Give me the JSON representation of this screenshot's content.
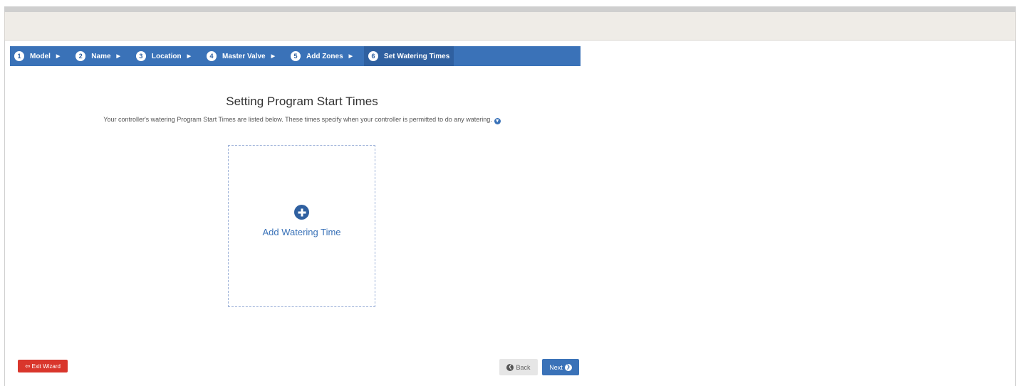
{
  "wizard": {
    "steps": [
      {
        "num": "1",
        "label": "Model"
      },
      {
        "num": "2",
        "label": "Name"
      },
      {
        "num": "3",
        "label": "Location"
      },
      {
        "num": "4",
        "label": "Master Valve"
      },
      {
        "num": "5",
        "label": "Add Zones"
      },
      {
        "num": "6",
        "label": "Set Watering Times"
      }
    ],
    "active_step": 6
  },
  "main": {
    "title": "Setting Program Start Times",
    "subtitle": "Your controller's watering Program Start Times are listed below. These times specify when your controller is permitted to do any watering.",
    "add_card_label": "Add Watering Time"
  },
  "footer": {
    "exit_label": "Exit Wizard",
    "back_label": "Back",
    "next_label": "Next"
  },
  "icons": {
    "info": "info-circle-icon",
    "add": "plus-circle-icon",
    "exit": "sign-out-icon",
    "back": "chevron-left-circle-icon",
    "next": "chevron-right-circle-icon"
  },
  "colors": {
    "primary": "#3a72b8",
    "primary_dark": "#2f60a0",
    "danger": "#d9362c",
    "header_band": "#efece7"
  }
}
